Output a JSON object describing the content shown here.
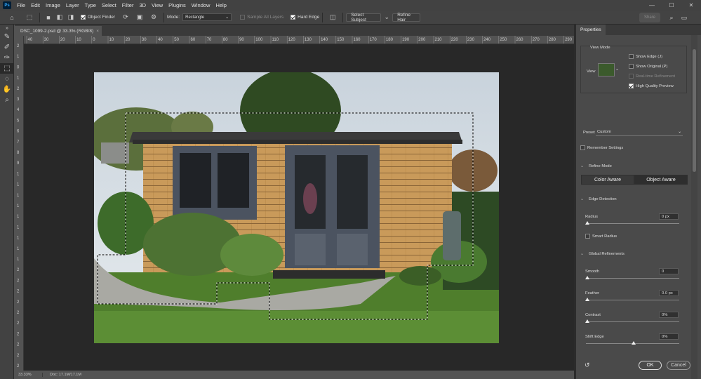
{
  "app": {
    "logo_text": "Ps",
    "menu": [
      "File",
      "Edit",
      "Image",
      "Layer",
      "Type",
      "Select",
      "Filter",
      "3D",
      "View",
      "Plugins",
      "Window",
      "Help"
    ],
    "window_controls": [
      "—",
      "☐",
      "✕"
    ]
  },
  "options": {
    "object_finder": "Object Finder",
    "mode_label": "Mode:",
    "mode_value": "Rectangle",
    "sample_all_layers": "Sample All Layers",
    "hard_edge": "Hard Edge",
    "select_subject": "Select Subject",
    "refine_hair": "Refine Hair",
    "share": "Share"
  },
  "document": {
    "tab_title": "DSC_1099-2.psd @ 33.3% (RGB/8)",
    "close": "×",
    "zoom": "33.33%",
    "doc_info": "Doc: 17.1M/17.1M"
  },
  "rulers": {
    "h_ticks": [
      "40",
      "30",
      "20",
      "10",
      "0",
      "10",
      "20",
      "30",
      "40",
      "50",
      "60",
      "70",
      "80",
      "90",
      "100",
      "110",
      "120",
      "130",
      "140",
      "150",
      "160",
      "170",
      "180",
      "190",
      "200",
      "210",
      "220",
      "230",
      "240",
      "250",
      "260",
      "270",
      "280",
      "290"
    ],
    "v_ticks": [
      "2",
      "1",
      "0",
      "1",
      "2",
      "3",
      "4",
      "5",
      "6",
      "7",
      "8",
      "9",
      "1",
      "1",
      "1",
      "1",
      "1",
      "1",
      "1",
      "1",
      "1",
      "2",
      "2",
      "2",
      "2",
      "2",
      "2",
      "2",
      "2",
      "2",
      "2"
    ]
  },
  "properties": {
    "tab": "Properties",
    "view_mode": "View Mode",
    "view_label": "View",
    "show_edge": "Show Edge (J)",
    "show_original": "Show Original (P)",
    "realtime_refinement": "Real-time Refinement",
    "high_quality_preview": "High Quality Preview",
    "preset_label": "Preset",
    "preset_value": "Custom",
    "remember_settings": "Remember Settings",
    "refine_mode": "Refine Mode",
    "color_aware": "Color Aware",
    "object_aware": "Object Aware",
    "edge_detection": "Edge Detection",
    "radius_label": "Radius",
    "radius_value": "0 px",
    "smart_radius": "Smart Radius",
    "global_refinements": "Global Refinements",
    "smooth_label": "Smooth",
    "smooth_value": "0",
    "feather_label": "Feather",
    "feather_value": "0.0 px",
    "contrast_label": "Contrast",
    "contrast_value": "0%",
    "shift_edge_label": "Shift Edge",
    "shift_edge_value": "0%",
    "ok": "OK",
    "cancel": "Cancel"
  }
}
